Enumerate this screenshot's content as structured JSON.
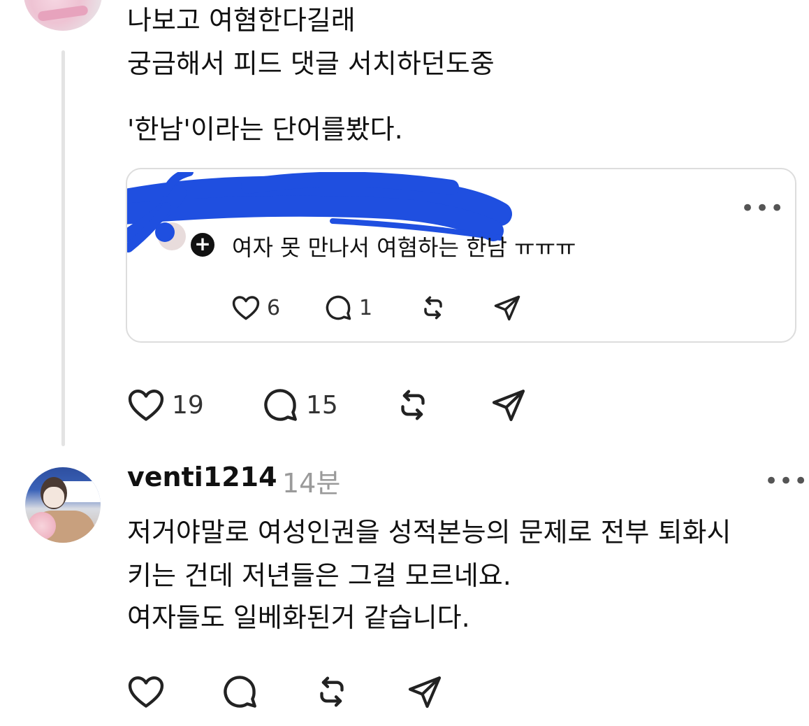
{
  "post": {
    "lines": [
      "나보고 여혐한다길래",
      "궁금해서 피드 댓글 서치하던도중",
      "'한남'이라는 단어를봤다."
    ],
    "quote": {
      "text": "여자 못 만나서 여혐하는 한남 ㅠㅠㅠ",
      "more": "•••",
      "plus": "+",
      "likes": "6",
      "replies": "1"
    },
    "likes": "19",
    "replies": "15"
  },
  "reply": {
    "username": "venti1214",
    "time": "14분",
    "more": "•••",
    "lines": [
      "저거야말로 여성인권을 성적본능의 문제로 전부 퇴화시",
      "키는 건데 저년들은 그걸 모르네요.",
      "여자들도 일베화된거 같습니다."
    ]
  },
  "colors": {
    "redaction": "#1f4fe0",
    "text": "#111111",
    "muted": "#9a9a9a",
    "border": "#dddddd"
  },
  "icons": [
    "heart-icon",
    "comment-icon",
    "repost-icon",
    "share-icon",
    "more-icon",
    "plus-icon"
  ]
}
